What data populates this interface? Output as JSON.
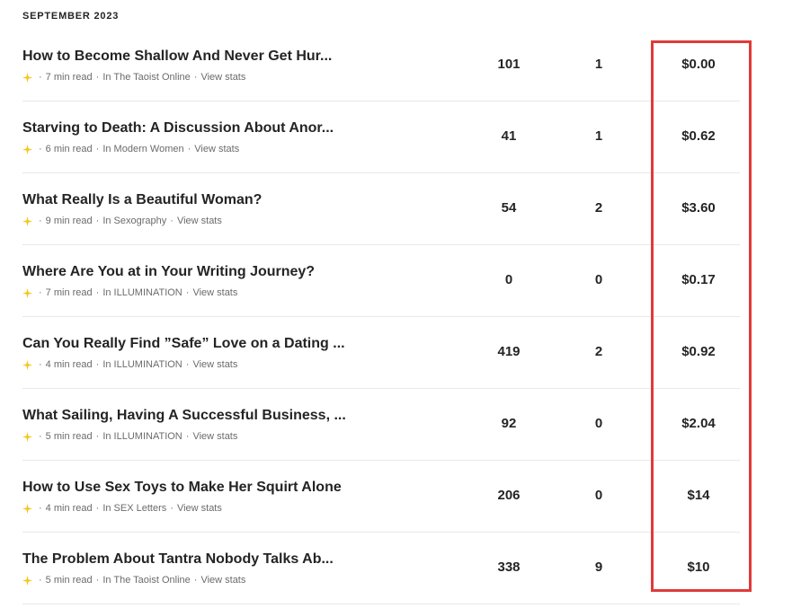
{
  "section": {
    "heading": "SEPTEMBER 2023"
  },
  "colors": {
    "highlight_border": "#e03a3a",
    "star": "#f5c518",
    "text": "#242424",
    "muted": "#6b6b6b"
  },
  "stories": [
    {
      "title": "How to Become Shallow And Never Get Hur...",
      "read_time": "7 min read",
      "publication": "In The Taoist Online",
      "view_stats": "View stats",
      "views": "101",
      "reads": "1",
      "earnings": "$0.00"
    },
    {
      "title": "Starving to Death: A Discussion About Anor...",
      "read_time": "6 min read",
      "publication": "In Modern Women",
      "view_stats": "View stats",
      "views": "41",
      "reads": "1",
      "earnings": "$0.62"
    },
    {
      "title": "What Really Is a Beautiful Woman?",
      "read_time": "9 min read",
      "publication": "In Sexography",
      "view_stats": "View stats",
      "views": "54",
      "reads": "2",
      "earnings": "$3.60"
    },
    {
      "title": "Where Are You at in Your Writing Journey?",
      "read_time": "7 min read",
      "publication": "In ILLUMINATION",
      "view_stats": "View stats",
      "views": "0",
      "reads": "0",
      "earnings": "$0.17"
    },
    {
      "title": "Can You Really Find ”Safe” Love on a Dating ...",
      "read_time": "4 min read",
      "publication": "In ILLUMINATION",
      "view_stats": "View stats",
      "views": "419",
      "reads": "2",
      "earnings": "$0.92"
    },
    {
      "title": "What Sailing, Having A Successful Business, ...",
      "read_time": "5 min read",
      "publication": "In ILLUMINATION",
      "view_stats": "View stats",
      "views": "92",
      "reads": "0",
      "earnings": "$2.04"
    },
    {
      "title": "How to Use Sex Toys to Make Her Squirt Alone",
      "read_time": "4 min read",
      "publication": "In SEX Letters",
      "view_stats": "View stats",
      "views": "206",
      "reads": "0",
      "earnings": "$14"
    },
    {
      "title": "The Problem About Tantra Nobody Talks Ab...",
      "read_time": "5 min read",
      "publication": "In The Taoist Online",
      "view_stats": "View stats",
      "views": "338",
      "reads": "9",
      "earnings": "$10"
    }
  ]
}
